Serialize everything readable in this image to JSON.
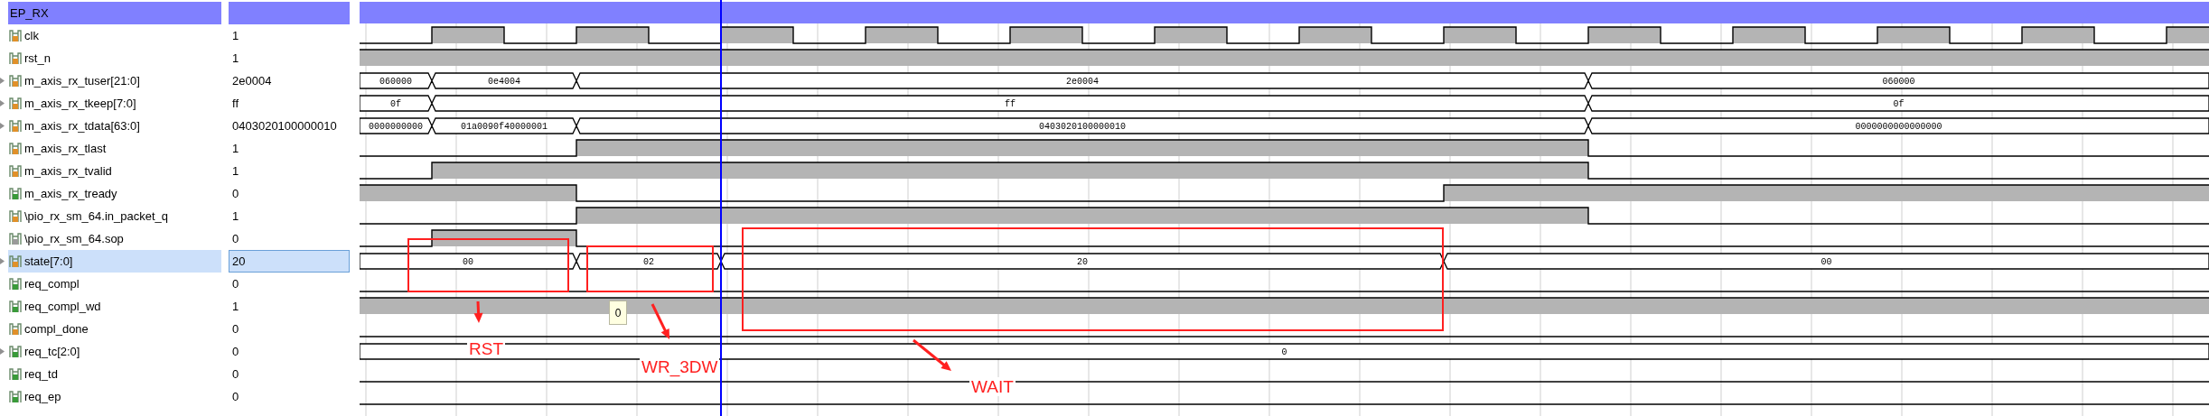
{
  "panel": {
    "title": "EP_RX"
  },
  "signals": [
    {
      "name": "clk",
      "value": "1",
      "kind": "bit",
      "color": "#e0902a",
      "selected": false
    },
    {
      "name": "rst_n",
      "value": "1",
      "kind": "bit",
      "color": "#e0902a",
      "selected": false
    },
    {
      "name": "m_axis_rx_tuser[21:0]",
      "value": "2e0004",
      "kind": "bus",
      "color": "#e0902a",
      "selected": false,
      "labels": [
        "060000",
        "0e4004",
        "2e0004",
        "060000"
      ]
    },
    {
      "name": "m_axis_rx_tkeep[7:0]",
      "value": "ff",
      "kind": "bus",
      "color": "#e0902a",
      "selected": false,
      "labels": [
        "0f",
        "ff",
        "0f"
      ]
    },
    {
      "name": "m_axis_rx_tdata[63:0]",
      "value": "0403020100000010",
      "kind": "bus",
      "color": "#e0902a",
      "selected": false,
      "labels": [
        "0000000000",
        "01a0090f40000001",
        "0403020100000010",
        "0000000000000000"
      ]
    },
    {
      "name": "m_axis_rx_tlast",
      "value": "1",
      "kind": "bit",
      "color": "#e0902a",
      "selected": false
    },
    {
      "name": "m_axis_rx_tvalid",
      "value": "1",
      "kind": "bit",
      "color": "#e0902a",
      "selected": false
    },
    {
      "name": "m_axis_rx_tready",
      "value": "0",
      "kind": "bit",
      "color": "#3a9a3a",
      "selected": false
    },
    {
      "name": "\\pio_rx_sm_64.in_packet_q",
      "value": "1",
      "kind": "bit",
      "color": "#e0902a",
      "selected": false
    },
    {
      "name": "\\pio_rx_sm_64.sop",
      "value": "0",
      "kind": "bit",
      "color": "#9a9a9a",
      "selected": false
    },
    {
      "name": "state[7:0]",
      "value": "20",
      "kind": "bus",
      "color": "#e0902a",
      "selected": true,
      "labels": [
        "00",
        "02",
        "20",
        "00"
      ]
    },
    {
      "name": "req_compl",
      "value": "0",
      "kind": "bit",
      "color": "#3a9a3a",
      "selected": false
    },
    {
      "name": "req_compl_wd",
      "value": "1",
      "kind": "bit",
      "color": "#3a9a3a",
      "selected": false
    },
    {
      "name": "compl_done",
      "value": "0",
      "kind": "bit",
      "color": "#e0902a",
      "selected": false
    },
    {
      "name": "req_tc[2:0]",
      "value": "0",
      "kind": "bus",
      "color": "#3a9a3a",
      "selected": false,
      "labels": [
        "0"
      ]
    },
    {
      "name": "req_td",
      "value": "0",
      "kind": "bit",
      "color": "#3a9a3a",
      "selected": false
    },
    {
      "name": "req_ep",
      "value": "0",
      "kind": "bit",
      "color": "#3a9a3a",
      "selected": false
    }
  ],
  "annotations": [
    {
      "label": "RST"
    },
    {
      "label": "WR_3DW"
    },
    {
      "label": "WAIT"
    }
  ],
  "tooltip": "0"
}
